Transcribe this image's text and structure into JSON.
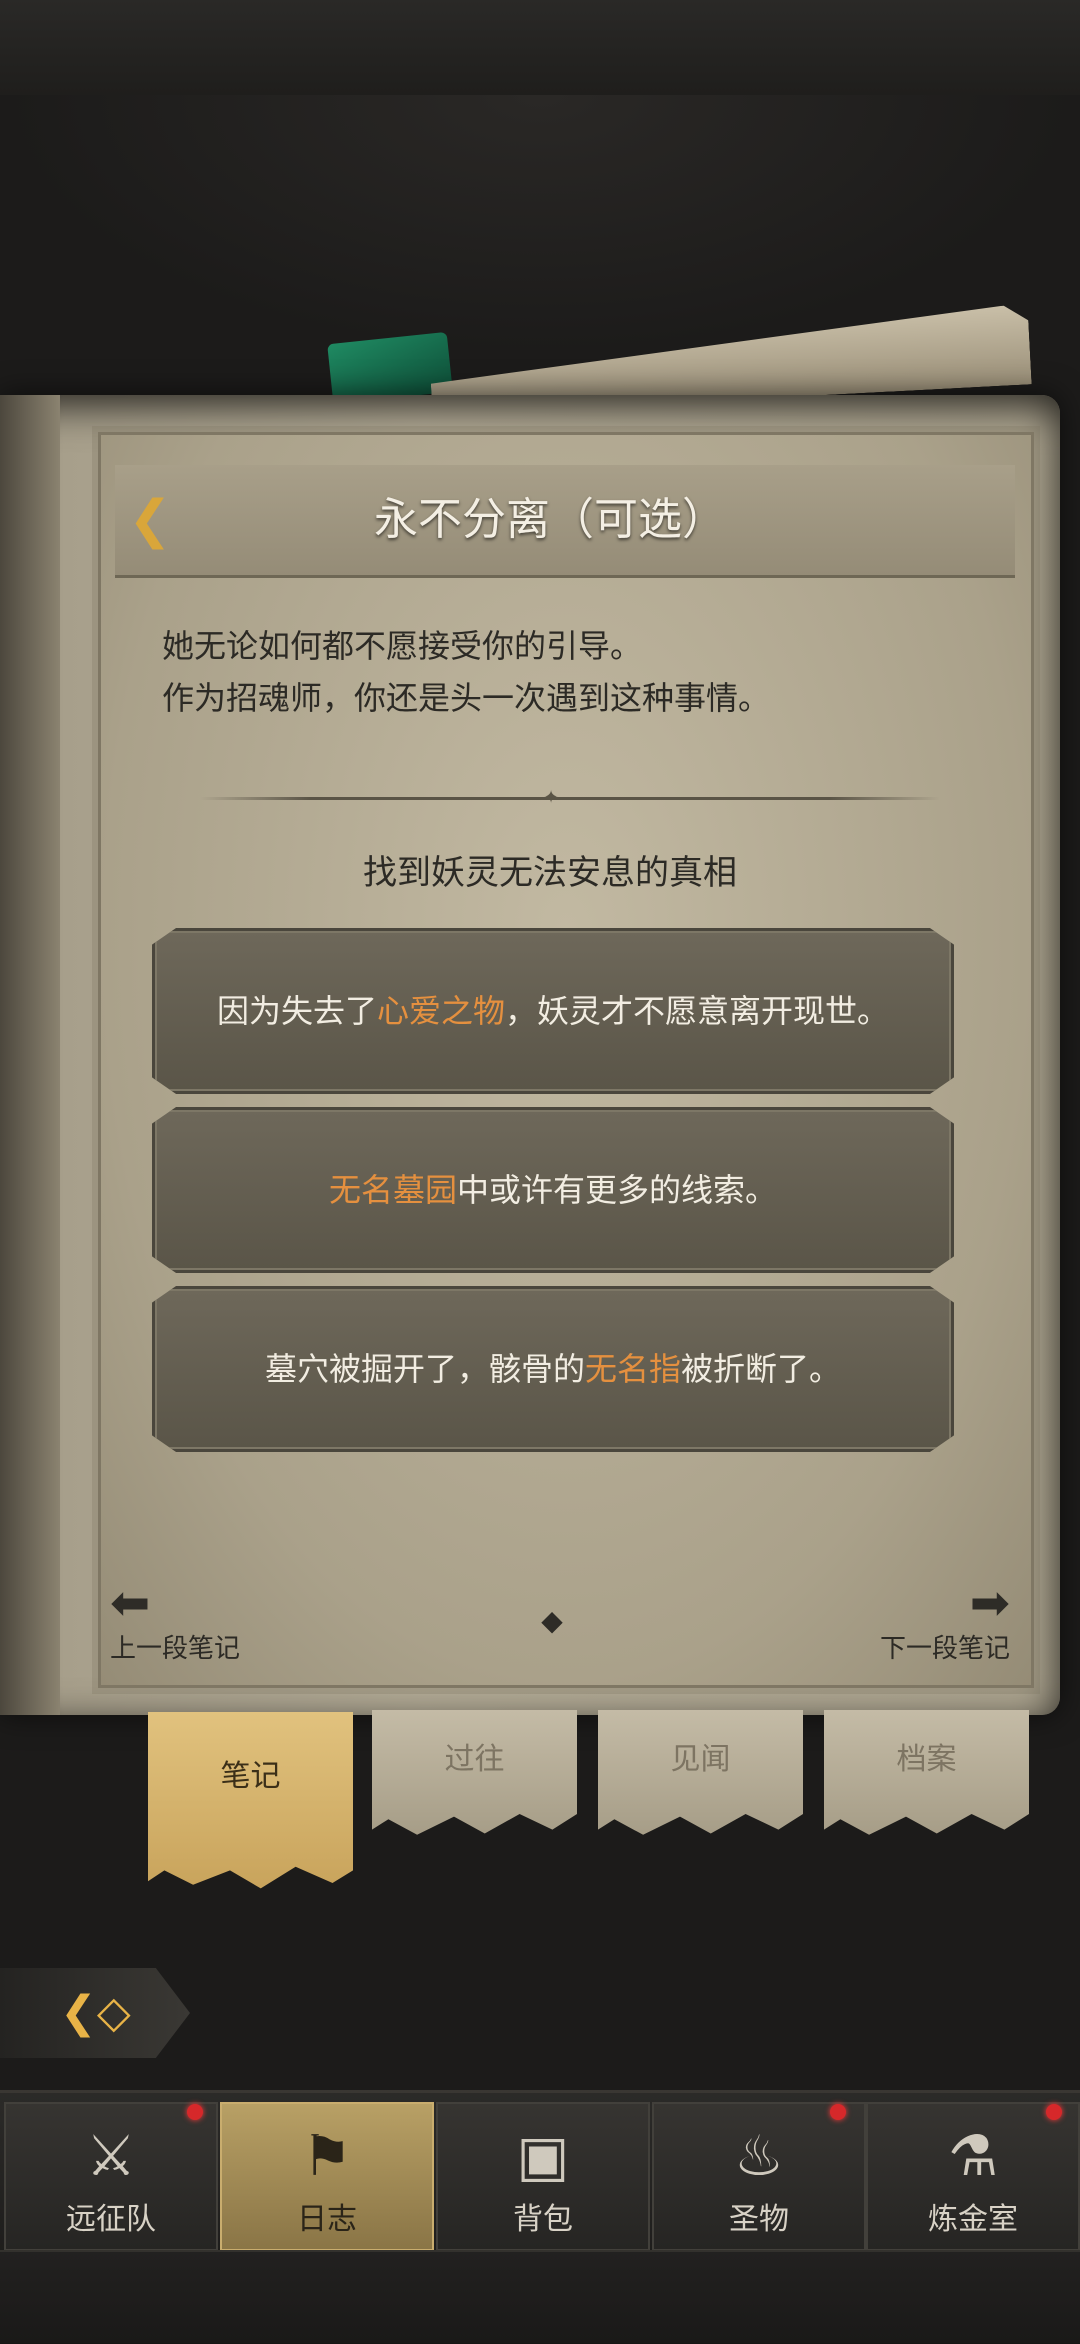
{
  "title": "永不分离（可选）",
  "description": [
    "她无论如何都不愿接受你的引导。",
    "作为招魂师，你还是头一次遇到这种事情。"
  ],
  "section_heading": "找到妖灵无法安息的真相",
  "clues": [
    {
      "before": "因为失去了",
      "highlight": "心爱之物",
      "after": "，妖灵才不愿意离开现世。"
    },
    {
      "before": "",
      "highlight": "无名墓园",
      "after": "中或许有更多的线索。"
    },
    {
      "before": "墓穴被掘开了，骸骨的",
      "highlight": "无名指",
      "after": "被折断了。"
    }
  ],
  "nav": {
    "prev_label": "上一段笔记",
    "next_label": "下一段笔记"
  },
  "tabs": [
    "笔记",
    "过往",
    "见闻",
    "档案"
  ],
  "active_tab": "笔记",
  "bottom_nav": [
    {
      "label": "远征队",
      "icon": "helmet-icon",
      "badge": true
    },
    {
      "label": "日志",
      "icon": "journal-icon",
      "badge": false
    },
    {
      "label": "背包",
      "icon": "backpack-icon",
      "badge": false
    },
    {
      "label": "圣物",
      "icon": "relic-icon",
      "badge": true
    },
    {
      "label": "炼金室",
      "icon": "alchemy-icon",
      "badge": true
    }
  ],
  "active_bottom_nav": "日志",
  "colors": {
    "highlight": "#e5903f",
    "accent_gold": "#d9a63a"
  }
}
